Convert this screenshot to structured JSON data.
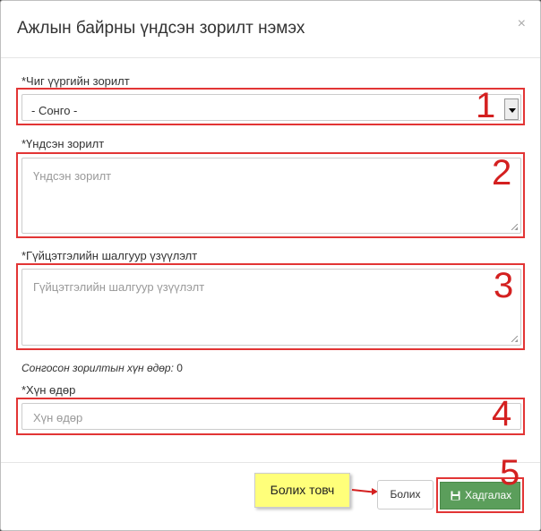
{
  "modal": {
    "title": "Ажлын байрны үндсэн зорилт нэмэх",
    "close_icon": "×"
  },
  "fields": {
    "goal_label": "*Чиг үүргийн зорилт",
    "goal_selected": "- Сонго -",
    "main_goal_label": "*Үндсэн зорилт",
    "main_goal_placeholder": "Үндсэн зорилт",
    "indicator_label": "*Гүйцэтгэлийн шалгуур үзүүлэлт",
    "indicator_placeholder": "Гүйцэтгэлийн шалгуур үзүүлэлт",
    "days_label": "*Хүн өдөр",
    "days_placeholder": "Хүн өдөр"
  },
  "info": {
    "selected_days_label": "Сонгосон зорилтын хүн өдөр:",
    "selected_days_value": "0"
  },
  "annotations": {
    "n1": "1",
    "n2": "2",
    "n3": "3",
    "n4": "4",
    "n5": "5",
    "callout": "Болих товч"
  },
  "footer": {
    "cancel_label": "Болих",
    "save_label": "Хадгалах"
  },
  "colors": {
    "highlight": "#e23535",
    "save_button": "#5b9e5b",
    "callout_bg": "#ffff7a"
  }
}
